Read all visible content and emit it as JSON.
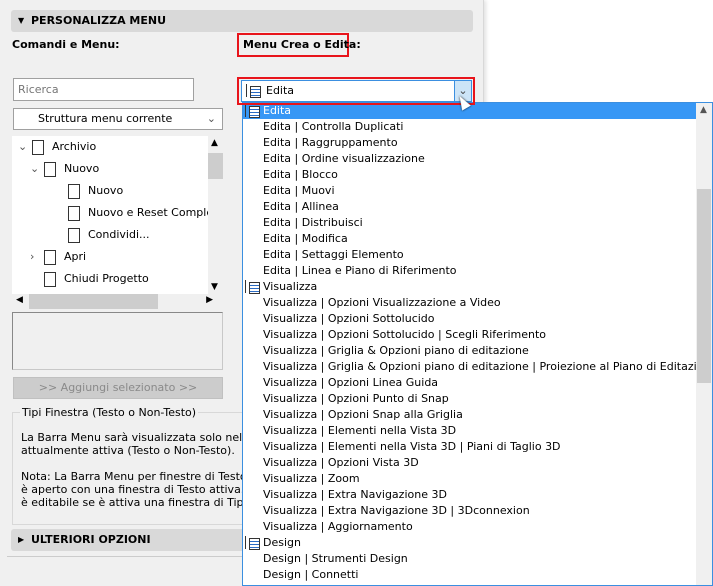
{
  "section_title": "PERSONALIZZA MENU",
  "commands_label": "Comandi e Menu:",
  "menu_label": "Menu Crea o Edita:",
  "search": {
    "placeholder": "Ricerca"
  },
  "structure_select": "Struttura menu corrente",
  "tree": [
    {
      "label": "Archivio",
      "level": 0,
      "expander": "expanded",
      "icon": "menu-icon"
    },
    {
      "label": "Nuovo",
      "level": 1,
      "expander": "expanded",
      "icon": "document-icon"
    },
    {
      "label": "Nuovo",
      "level": 2,
      "icon": "document-icon"
    },
    {
      "label": "Nuovo e Reset Completo",
      "level": 2,
      "icon": "reset-document-icon"
    },
    {
      "label": "Condividi...",
      "level": 2,
      "icon": "share-icon"
    },
    {
      "label": "Apri",
      "level": 1,
      "expander": "collapsed",
      "icon": "open-folder-icon"
    },
    {
      "label": "Chiudi Progetto",
      "level": 1,
      "icon": "close-document-icon"
    }
  ],
  "add_button": ">> Aggiungi selezionato >>",
  "window_types": {
    "title": "Tipi Finestra (Testo o Non-Testo)",
    "text": "La Barra Menu sarà visualizzata solo nelle fi\nattualmente attiva (Testo o Non-Testo).\n\nNota: La Barra Menu per finestre di Testo è\nè aperto con una finestra di Testo attiva. La\nè editabile se è attiva una finestra di Tipo N"
  },
  "more_options": "ULTERIORI OPZIONI",
  "menu_select": {
    "value": "Edita"
  },
  "menu_list": [
    {
      "label": "Edita",
      "header": true,
      "selected": true
    },
    {
      "label": "Edita | Controlla Duplicati"
    },
    {
      "label": "Edita | Raggruppamento"
    },
    {
      "label": "Edita | Ordine visualizzazione"
    },
    {
      "label": "Edita | Blocco"
    },
    {
      "label": "Edita | Muovi"
    },
    {
      "label": "Edita | Allinea"
    },
    {
      "label": "Edita | Distribuisci"
    },
    {
      "label": "Edita | Modifica"
    },
    {
      "label": "Edita | Settaggi Elemento"
    },
    {
      "label": "Edita | Linea e Piano di Riferimento"
    },
    {
      "label": "Visualizza",
      "header": true
    },
    {
      "label": "Visualizza | Opzioni Visualizzazione a Video"
    },
    {
      "label": "Visualizza | Opzioni Sottolucido"
    },
    {
      "label": "Visualizza | Opzioni Sottolucido | Scegli Riferimento"
    },
    {
      "label": "Visualizza | Griglia & Opzioni piano di editazione"
    },
    {
      "label": "Visualizza | Griglia & Opzioni piano di editazione | Proiezione al Piano di Editazione"
    },
    {
      "label": "Visualizza | Opzioni Linea Guida"
    },
    {
      "label": "Visualizza | Opzioni Punto di Snap"
    },
    {
      "label": "Visualizza | Opzioni Snap alla Griglia"
    },
    {
      "label": "Visualizza | Elementi nella Vista 3D"
    },
    {
      "label": "Visualizza | Elementi nella Vista 3D | Piani di Taglio 3D"
    },
    {
      "label": "Visualizza | Opzioni Vista 3D"
    },
    {
      "label": "Visualizza | Zoom"
    },
    {
      "label": "Visualizza | Extra Navigazione 3D"
    },
    {
      "label": "Visualizza | Extra Navigazione 3D | 3Dconnexion"
    },
    {
      "label": "Visualizza | Aggiornamento"
    },
    {
      "label": "Design",
      "header": true
    },
    {
      "label": "Design | Strumenti Design"
    },
    {
      "label": "Design | Connetti"
    }
  ],
  "colors": {
    "highlight": "#3797f5",
    "callout": "#e8141b"
  }
}
